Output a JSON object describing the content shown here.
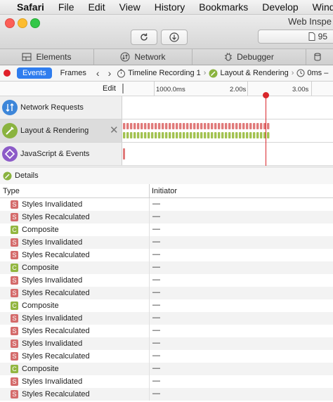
{
  "menubar": {
    "items": [
      "Safari",
      "File",
      "Edit",
      "View",
      "History",
      "Bookmarks",
      "Develop",
      "Window"
    ]
  },
  "window": {
    "title": "Web Inspe",
    "console_count": "95"
  },
  "tabs": [
    {
      "label": "Elements",
      "icon": "elements-icon"
    },
    {
      "label": "Network",
      "icon": "network-icon"
    },
    {
      "label": "Debugger",
      "icon": "debugger-icon"
    }
  ],
  "navbar": {
    "events_label": "Events",
    "frames_label": "Frames",
    "crumb1": "Timeline Recording 1",
    "crumb2": "Layout & Rendering",
    "crumb3": "0ms –"
  },
  "overview": {
    "edit_label": "Edit",
    "ticks": [
      "1000.0ms",
      "2.00s",
      "3.00s"
    ],
    "rows": [
      {
        "label": "Network Requests",
        "icon": "network-requests-icon",
        "color": "#3d86d9"
      },
      {
        "label": "Layout & Rendering",
        "icon": "layout-rendering-icon",
        "color": "#8ab33f"
      },
      {
        "label": "JavaScript & Events",
        "icon": "javascript-events-icon",
        "color": "#8c5bc8"
      }
    ],
    "colors": {
      "styles": "#e07a7a",
      "composite": "#a2c250",
      "playhead": "#d9262b"
    }
  },
  "details": {
    "label": "Details",
    "col_type": "Type",
    "col_initiator": "Initiator"
  },
  "records": [
    {
      "badge": "S",
      "kind": "s",
      "name": "Styles Invalidated",
      "initiator": "—"
    },
    {
      "badge": "S",
      "kind": "s",
      "name": "Styles Recalculated",
      "initiator": "—"
    },
    {
      "badge": "C",
      "kind": "c",
      "name": "Composite",
      "initiator": "—"
    },
    {
      "badge": "S",
      "kind": "s",
      "name": "Styles Invalidated",
      "initiator": "—"
    },
    {
      "badge": "S",
      "kind": "s",
      "name": "Styles Recalculated",
      "initiator": "—"
    },
    {
      "badge": "C",
      "kind": "c",
      "name": "Composite",
      "initiator": "—"
    },
    {
      "badge": "S",
      "kind": "s",
      "name": "Styles Invalidated",
      "initiator": "—"
    },
    {
      "badge": "S",
      "kind": "s",
      "name": "Styles Recalculated",
      "initiator": "—"
    },
    {
      "badge": "C",
      "kind": "c",
      "name": "Composite",
      "initiator": "—"
    },
    {
      "badge": "S",
      "kind": "s",
      "name": "Styles Invalidated",
      "initiator": "—"
    },
    {
      "badge": "S",
      "kind": "s",
      "name": "Styles Recalculated",
      "initiator": "—"
    },
    {
      "badge": "S",
      "kind": "s",
      "name": "Styles Invalidated",
      "initiator": "—"
    },
    {
      "badge": "S",
      "kind": "s",
      "name": "Styles Recalculated",
      "initiator": "—"
    },
    {
      "badge": "C",
      "kind": "c",
      "name": "Composite",
      "initiator": "—"
    },
    {
      "badge": "S",
      "kind": "s",
      "name": "Styles Invalidated",
      "initiator": "—"
    },
    {
      "badge": "S",
      "kind": "s",
      "name": "Styles Recalculated",
      "initiator": "—"
    }
  ]
}
